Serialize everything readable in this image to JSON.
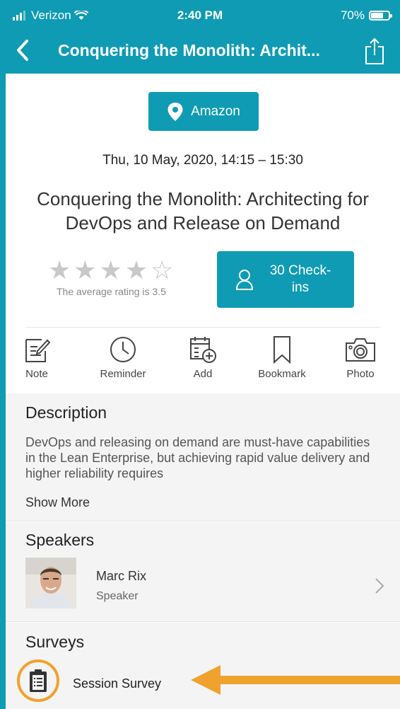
{
  "status_bar": {
    "carrier": "Verizon",
    "time": "2:40 PM",
    "battery": "70%"
  },
  "nav": {
    "title": "Conquering the Monolith: Archit...",
    "back_icon": "chevron-left-icon",
    "share_icon": "share-icon"
  },
  "location_button": {
    "label": "Amazon",
    "icon": "map-pin-icon"
  },
  "session": {
    "datetime": "Thu, 10 May, 2020, 14:15 – 15:30",
    "title": "Conquering the Monolith: Architecting for DevOps and Release on Demand"
  },
  "rating": {
    "text": "The average rating is 3.5",
    "value": 3.5,
    "max": 5
  },
  "checkin": {
    "label": "30 Check-ins"
  },
  "actions": [
    {
      "label": "Note",
      "icon": "note-icon"
    },
    {
      "label": "Reminder",
      "icon": "clock-icon"
    },
    {
      "label": "Add",
      "icon": "calendar-add-icon"
    },
    {
      "label": "Bookmark",
      "icon": "bookmark-icon"
    },
    {
      "label": "Photo",
      "icon": "camera-icon"
    }
  ],
  "description": {
    "heading": "Description",
    "text": "DevOps and releasing on demand are must-have capabilities in the Lean Enterprise, but achieving rapid value delivery and higher reliability requires",
    "show_more": "Show More"
  },
  "speakers": {
    "heading": "Speakers",
    "items": [
      {
        "name": "Marc Rix",
        "role": "Speaker"
      }
    ]
  },
  "surveys": {
    "heading": "Surveys",
    "items": [
      {
        "label": "Session Survey",
        "icon": "clipboard-icon"
      }
    ]
  },
  "colors": {
    "accent": "#0f9bb3",
    "highlight": "#f0a22e"
  }
}
